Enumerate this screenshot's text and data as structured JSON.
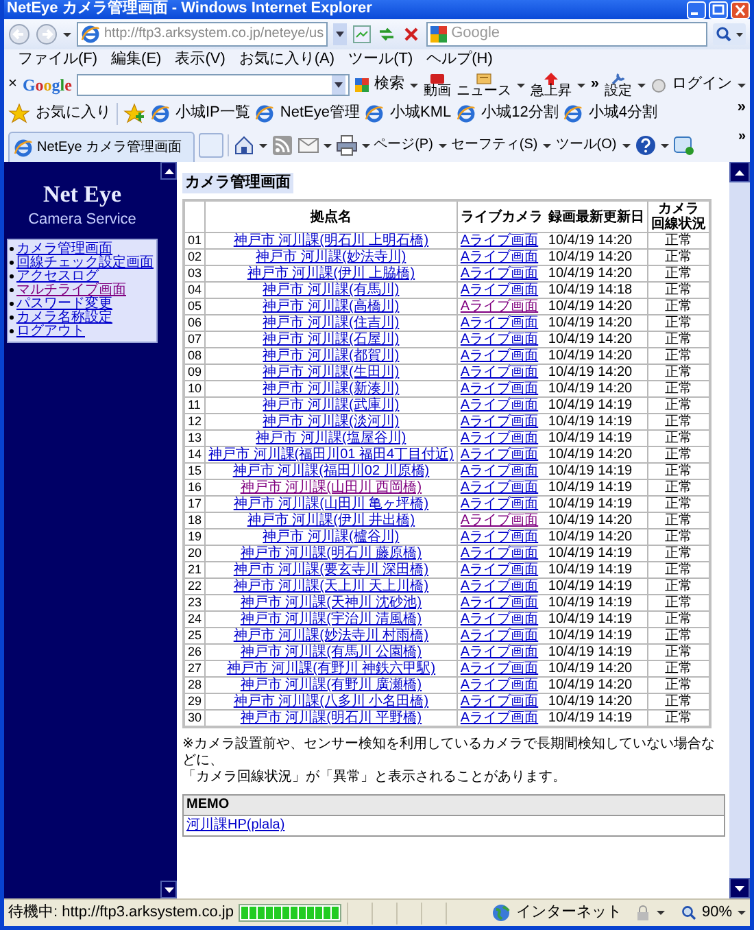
{
  "window": {
    "title": "NetEye カメラ管理画面 - Windows Internet Explorer"
  },
  "address_bar": {
    "url": "http://ftp3.arksystem.co.jp/neteye/us"
  },
  "search_box": {
    "placeholder": "Google"
  },
  "menu": [
    "ファイル(F)",
    "編集(E)",
    "表示(V)",
    "お気に入り(A)",
    "ツール(T)",
    "ヘルプ(H)"
  ],
  "google_toolbar": {
    "close": "×",
    "logo": "Google",
    "items": [
      {
        "kind": "search",
        "label": "検索"
      },
      {
        "kind": "video",
        "label": "動画"
      },
      {
        "kind": "news",
        "label": "ニュース"
      },
      {
        "kind": "trend",
        "label": "急上昇"
      },
      {
        "kind": "more",
        "label": "»"
      },
      {
        "kind": "settings",
        "label": "設定"
      },
      {
        "kind": "login",
        "label": "ログイン"
      }
    ]
  },
  "favorites_bar": {
    "label": "お気に入り",
    "links": [
      "小城IP一覧",
      "NetEye管理",
      "小城KML",
      "小城12分割",
      "小城4分割"
    ],
    "more": "»"
  },
  "tabs": [
    {
      "label": "NetEye カメラ管理画面",
      "selected": true
    }
  ],
  "command_bar": {
    "menus": [
      "ページ(P)",
      "セーフティ(S)",
      "ツール(O)"
    ],
    "more": "»"
  },
  "sidebar": {
    "title": "Net Eye",
    "subtitle": "Camera Service",
    "links": [
      {
        "label": "カメラ管理画面",
        "visited": false
      },
      {
        "label": "回線チェック設定画面",
        "visited": false
      },
      {
        "label": "アクセスログ",
        "visited": false
      },
      {
        "label": "マルチライブ画面",
        "visited": true
      },
      {
        "label": "パスワード変更",
        "visited": false
      },
      {
        "label": "カメラ名称設定",
        "visited": false
      },
      {
        "label": "ログアウト",
        "visited": false
      }
    ]
  },
  "page": {
    "heading": "カメラ管理画面",
    "columns": [
      {
        "lines": [
          "拠点名"
        ]
      },
      {
        "lines": [
          "ライブカメラ"
        ]
      },
      {
        "lines": [
          "録画最新更新日"
        ]
      },
      {
        "lines": [
          "カメラ",
          "回線状況"
        ]
      }
    ],
    "rows": [
      {
        "no": "01",
        "name": "神戸市 河川課(明石川 上明石橋)",
        "name_visited": false,
        "live": "Aライブ画面",
        "live_visited": false,
        "updated": "10/4/19 14:20",
        "status": "正常"
      },
      {
        "no": "02",
        "name": "神戸市 河川課(妙法寺川)",
        "name_visited": false,
        "live": "Aライブ画面",
        "live_visited": false,
        "updated": "10/4/19 14:20",
        "status": "正常"
      },
      {
        "no": "03",
        "name": "神戸市 河川課(伊川 上脇橋)",
        "name_visited": false,
        "live": "Aライブ画面",
        "live_visited": false,
        "updated": "10/4/19 14:20",
        "status": "正常"
      },
      {
        "no": "04",
        "name": "神戸市 河川課(有馬川)",
        "name_visited": false,
        "live": "Aライブ画面",
        "live_visited": false,
        "updated": "10/4/19 14:18",
        "status": "正常"
      },
      {
        "no": "05",
        "name": "神戸市 河川課(高橋川)",
        "name_visited": false,
        "live": "Aライブ画面",
        "live_visited": true,
        "updated": "10/4/19 14:20",
        "status": "正常"
      },
      {
        "no": "06",
        "name": "神戸市 河川課(住吉川)",
        "name_visited": false,
        "live": "Aライブ画面",
        "live_visited": false,
        "updated": "10/4/19 14:20",
        "status": "正常"
      },
      {
        "no": "07",
        "name": "神戸市 河川課(石屋川)",
        "name_visited": false,
        "live": "Aライブ画面",
        "live_visited": false,
        "updated": "10/4/19 14:20",
        "status": "正常"
      },
      {
        "no": "08",
        "name": "神戸市 河川課(都賀川)",
        "name_visited": false,
        "live": "Aライブ画面",
        "live_visited": false,
        "updated": "10/4/19 14:20",
        "status": "正常"
      },
      {
        "no": "09",
        "name": "神戸市 河川課(生田川)",
        "name_visited": false,
        "live": "Aライブ画面",
        "live_visited": false,
        "updated": "10/4/19 14:20",
        "status": "正常"
      },
      {
        "no": "10",
        "name": "神戸市 河川課(新湊川)",
        "name_visited": false,
        "live": "Aライブ画面",
        "live_visited": false,
        "updated": "10/4/19 14:20",
        "status": "正常"
      },
      {
        "no": "11",
        "name": "神戸市 河川課(武庫川)",
        "name_visited": false,
        "live": "Aライブ画面",
        "live_visited": false,
        "updated": "10/4/19 14:19",
        "status": "正常"
      },
      {
        "no": "12",
        "name": "神戸市 河川課(淡河川)",
        "name_visited": false,
        "live": "Aライブ画面",
        "live_visited": false,
        "updated": "10/4/19 14:19",
        "status": "正常"
      },
      {
        "no": "13",
        "name": "神戸市 河川課(塩屋谷川)",
        "name_visited": false,
        "live": "Aライブ画面",
        "live_visited": false,
        "updated": "10/4/19 14:19",
        "status": "正常"
      },
      {
        "no": "14",
        "name": "神戸市 河川課(福田川01 福田4丁目付近)",
        "name_visited": false,
        "live": "Aライブ画面",
        "live_visited": false,
        "updated": "10/4/19 14:20",
        "status": "正常"
      },
      {
        "no": "15",
        "name": "神戸市 河川課(福田川02 川原橋)",
        "name_visited": false,
        "live": "Aライブ画面",
        "live_visited": false,
        "updated": "10/4/19 14:19",
        "status": "正常"
      },
      {
        "no": "16",
        "name": "神戸市 河川課(山田川 西岡橋)",
        "name_visited": true,
        "live": "Aライブ画面",
        "live_visited": false,
        "updated": "10/4/19 14:19",
        "status": "正常"
      },
      {
        "no": "17",
        "name": "神戸市 河川課(山田川 亀ヶ坪橋)",
        "name_visited": false,
        "live": "Aライブ画面",
        "live_visited": false,
        "updated": "10/4/19 14:19",
        "status": "正常"
      },
      {
        "no": "18",
        "name": "神戸市 河川課(伊川 井出橋)",
        "name_visited": false,
        "live": "Aライブ画面",
        "live_visited": true,
        "updated": "10/4/19 14:20",
        "status": "正常"
      },
      {
        "no": "19",
        "name": "神戸市 河川課(櫨谷川)",
        "name_visited": false,
        "live": "Aライブ画面",
        "live_visited": false,
        "updated": "10/4/19 14:20",
        "status": "正常"
      },
      {
        "no": "20",
        "name": "神戸市 河川課(明石川 藤原橋)",
        "name_visited": false,
        "live": "Aライブ画面",
        "live_visited": false,
        "updated": "10/4/19 14:19",
        "status": "正常"
      },
      {
        "no": "21",
        "name": "神戸市 河川課(要玄寺川 深田橋)",
        "name_visited": false,
        "live": "Aライブ画面",
        "live_visited": false,
        "updated": "10/4/19 14:19",
        "status": "正常"
      },
      {
        "no": "22",
        "name": "神戸市 河川課(天上川 天上川橋)",
        "name_visited": false,
        "live": "Aライブ画面",
        "live_visited": false,
        "updated": "10/4/19 14:19",
        "status": "正常"
      },
      {
        "no": "23",
        "name": "神戸市 河川課(天神川 沈砂池)",
        "name_visited": false,
        "live": "Aライブ画面",
        "live_visited": false,
        "updated": "10/4/19 14:19",
        "status": "正常"
      },
      {
        "no": "24",
        "name": "神戸市 河川課(宇治川 清風橋)",
        "name_visited": false,
        "live": "Aライブ画面",
        "live_visited": false,
        "updated": "10/4/19 14:19",
        "status": "正常"
      },
      {
        "no": "25",
        "name": "神戸市 河川課(妙法寺川 村雨橋)",
        "name_visited": false,
        "live": "Aライブ画面",
        "live_visited": false,
        "updated": "10/4/19 14:19",
        "status": "正常"
      },
      {
        "no": "26",
        "name": "神戸市 河川課(有馬川 公園橋)",
        "name_visited": false,
        "live": "Aライブ画面",
        "live_visited": false,
        "updated": "10/4/19 14:19",
        "status": "正常"
      },
      {
        "no": "27",
        "name": "神戸市 河川課(有野川 神鉄六甲駅)",
        "name_visited": false,
        "live": "Aライブ画面",
        "live_visited": false,
        "updated": "10/4/19 14:20",
        "status": "正常"
      },
      {
        "no": "28",
        "name": "神戸市 河川課(有野川 廣瀬橋)",
        "name_visited": false,
        "live": "Aライブ画面",
        "live_visited": false,
        "updated": "10/4/19 14:20",
        "status": "正常"
      },
      {
        "no": "29",
        "name": "神戸市 河川課(八多川 小名田橋)",
        "name_visited": false,
        "live": "Aライブ画面",
        "live_visited": false,
        "updated": "10/4/19 14:20",
        "status": "正常"
      },
      {
        "no": "30",
        "name": "神戸市 河川課(明石川 平野橋)",
        "name_visited": false,
        "live": "Aライブ画面",
        "live_visited": false,
        "updated": "10/4/19 14:19",
        "status": "正常"
      }
    ],
    "note": [
      "※カメラ設置前や、センサー検知を利用しているカメラで長期間検知していない場合などに、",
      "「カメラ回線状況」が「異常」と表示されることがあります。"
    ],
    "memo": {
      "title": "MEMO",
      "links": [
        "河川課HP(plala)"
      ]
    }
  },
  "status_bar": {
    "text": "待機中: http://ftp3.arksystem.co.jp",
    "progress": {
      "level": 1
    },
    "zone": "インターネット",
    "zoom": "90%"
  }
}
